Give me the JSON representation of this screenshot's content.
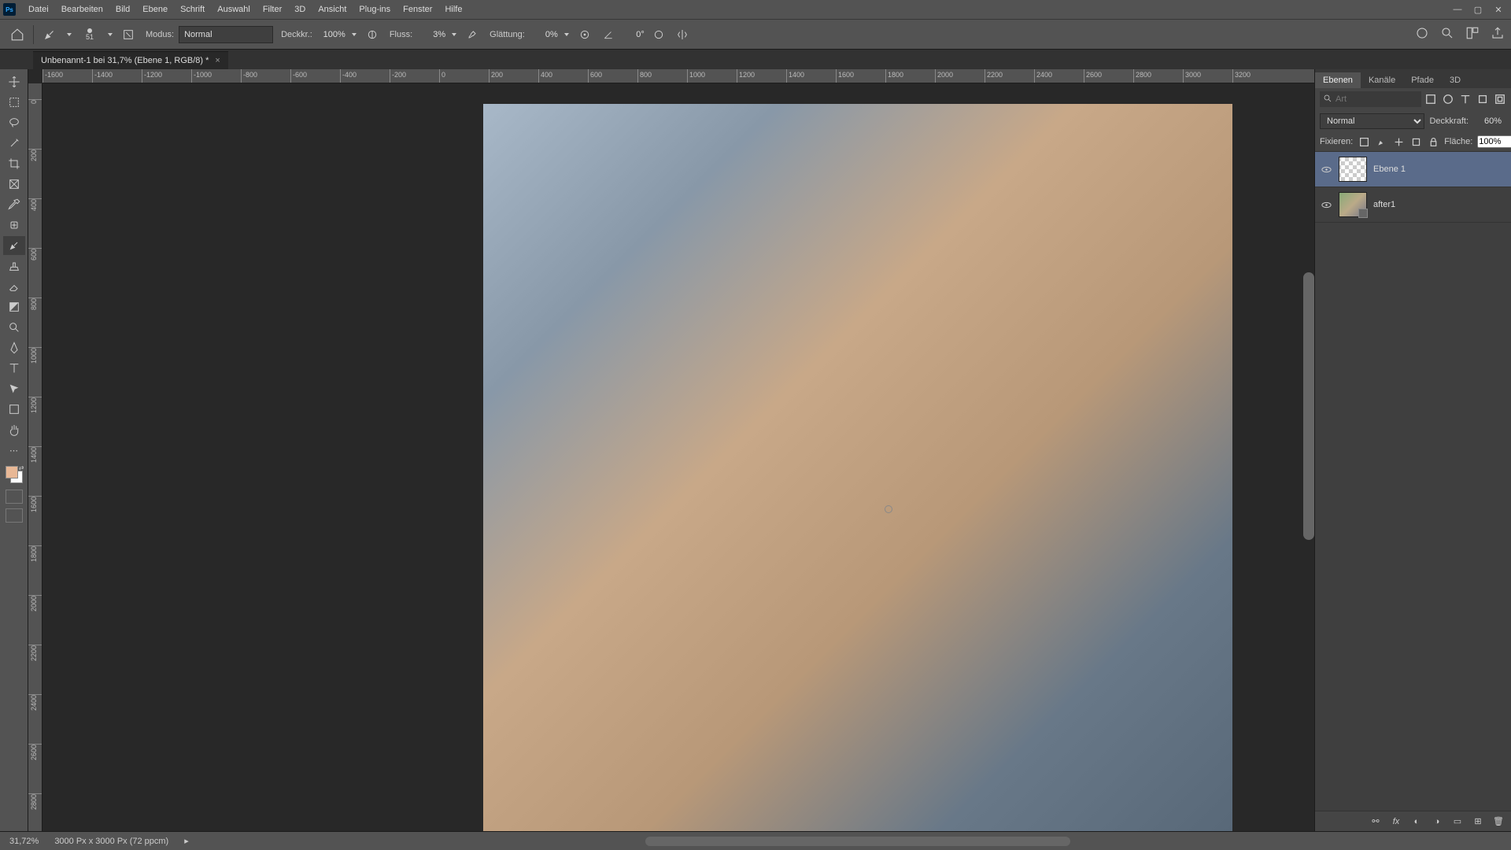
{
  "app": {
    "icon_text": "Ps"
  },
  "menu": {
    "items": [
      "Datei",
      "Bearbeiten",
      "Bild",
      "Ebene",
      "Schrift",
      "Auswahl",
      "Filter",
      "3D",
      "Ansicht",
      "Plug-ins",
      "Fenster",
      "Hilfe"
    ]
  },
  "window_controls": {
    "min": "—",
    "max": "▢",
    "close": "✕"
  },
  "options": {
    "brush_size": "51",
    "mode_label": "Modus:",
    "mode_value": "Normal",
    "opacity_label": "Deckkr.:",
    "opacity_value": "100%",
    "flow_label": "Fluss:",
    "flow_value": "3%",
    "smoothing_label": "Glättung:",
    "smoothing_value": "0%",
    "angle_value": "0°"
  },
  "document": {
    "tab_title": "Unbenannt-1 bei 31,7% (Ebene 1, RGB/8) *"
  },
  "ruler": {
    "h_ticks": [
      "-1600",
      "-1400",
      "-1200",
      "-1000",
      "-800",
      "-600",
      "-400",
      "-200",
      "0",
      "200",
      "400",
      "600",
      "800",
      "1000",
      "1200",
      "1400",
      "1600",
      "1800",
      "2000",
      "2200",
      "2400",
      "2600",
      "2800",
      "3000",
      "3200"
    ],
    "v_ticks": [
      "0",
      "200",
      "400",
      "600",
      "800",
      "1000",
      "1200",
      "1400",
      "1600",
      "1800",
      "2000",
      "2200",
      "2400",
      "2600",
      "2800"
    ]
  },
  "panels": {
    "tabs": [
      "Ebenen",
      "Kanäle",
      "Pfade",
      "3D"
    ],
    "active_tab": 0,
    "search_placeholder": "Art",
    "blend_mode": "Normal",
    "opacity_label": "Deckkraft:",
    "opacity_value": "60%",
    "lock_label": "Fixieren:",
    "fill_label": "Fläche:",
    "fill_value": "100%",
    "layers": [
      {
        "name": "Ebene 1",
        "visible": true,
        "selected": true,
        "thumb": "checker"
      },
      {
        "name": "after1",
        "visible": true,
        "selected": false,
        "thumb": "image"
      }
    ]
  },
  "status": {
    "zoom": "31,72%",
    "info": "3000 Px x 3000 Px (72 ppcm)"
  },
  "colors": {
    "fg": "#e8b896",
    "bg": "#ffffff"
  }
}
